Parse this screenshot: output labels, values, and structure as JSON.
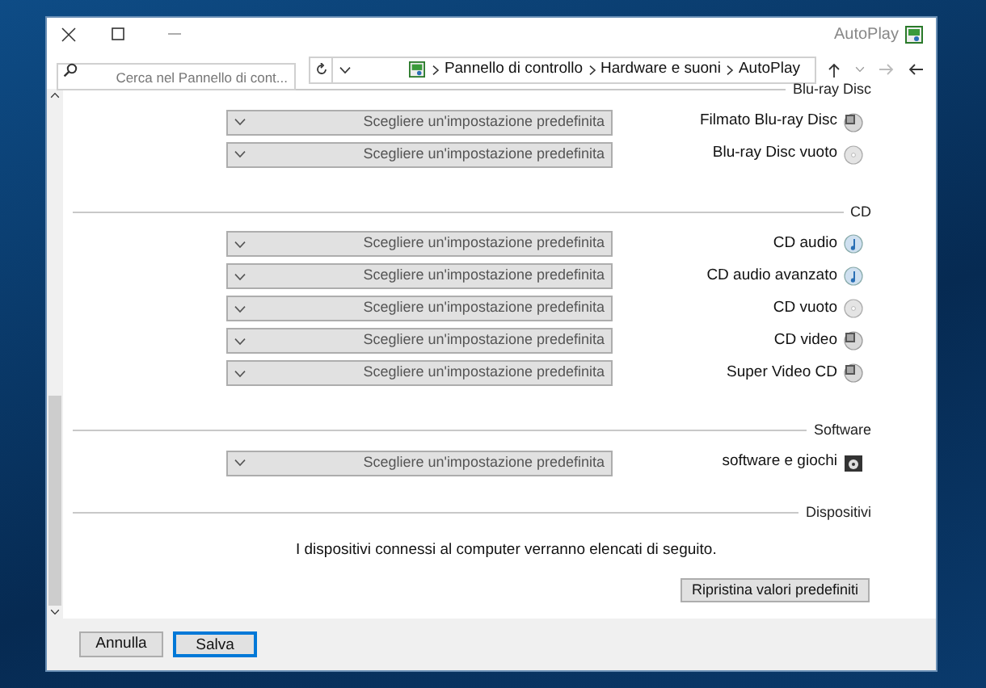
{
  "window": {
    "title": "AutoPlay"
  },
  "address_bar": {
    "breadcrumbs": [
      "Pannello di controllo",
      "Hardware e suoni",
      "AutoPlay"
    ],
    "search": {
      "placeholder": "Cerca nel Pannello di cont..."
    }
  },
  "sections": [
    {
      "title": "Blu-ray Disc",
      "items": [
        {
          "label": "Filmato Blu-ray Disc",
          "kind": "film",
          "value": "Scegliere un'impostazione predefinita"
        },
        {
          "label": "Blu-ray Disc vuoto",
          "kind": "disc",
          "value": "Scegliere un'impostazione predefinita"
        }
      ]
    },
    {
      "title": "CD",
      "items": [
        {
          "label": "CD audio",
          "kind": "audio",
          "value": "Scegliere un'impostazione predefinita"
        },
        {
          "label": "CD audio avanzato",
          "kind": "audio",
          "value": "Scegliere un'impostazione predefinita"
        },
        {
          "label": "CD vuoto",
          "kind": "disc",
          "value": "Scegliere un'impostazione predefinita"
        },
        {
          "label": "CD video",
          "kind": "film",
          "value": "Scegliere un'impostazione predefinita"
        },
        {
          "label": "Super Video CD",
          "kind": "film",
          "value": "Scegliere un'impostazione predefinita"
        }
      ]
    },
    {
      "title": "Software",
      "items": [
        {
          "label": "software e giochi",
          "kind": "software",
          "value": "Scegliere un'impostazione predefinita"
        }
      ]
    },
    {
      "title": "Dispositivi"
    }
  ],
  "devices_note": "I dispositivi connessi al computer verranno elencati di seguito.",
  "reset_button": "Ripristina valori predefiniti",
  "buttons": [
    {
      "label": "Annulla",
      "selected": false
    },
    {
      "label": "Salva",
      "selected": true
    }
  ]
}
